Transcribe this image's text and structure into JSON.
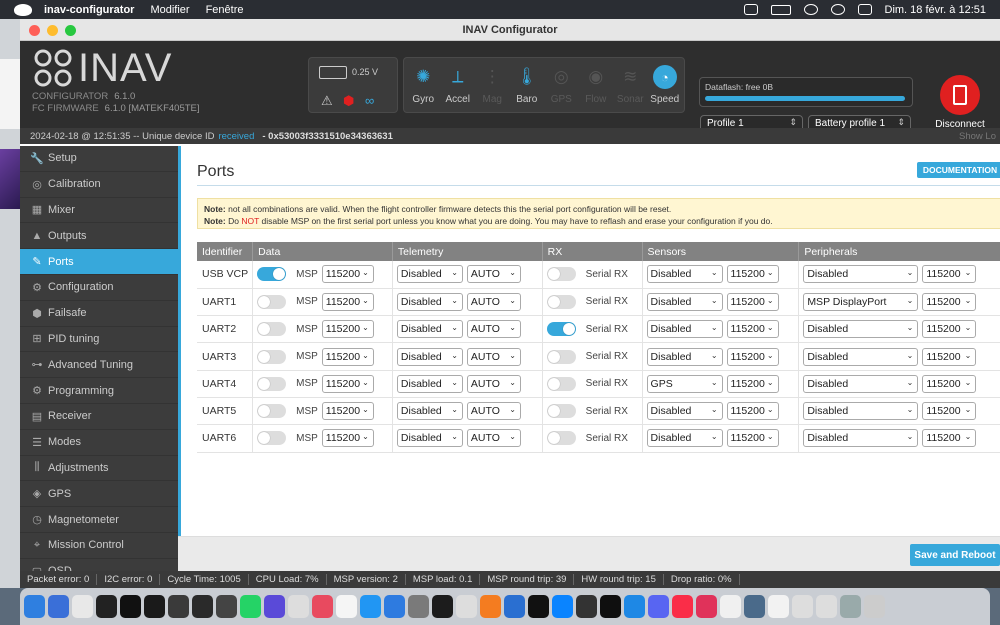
{
  "menubar": {
    "app": "inav-configurator",
    "menu1": "Modifier",
    "menu2": "Fenêtre",
    "datetime": "Dim. 18 févr. à 12:51"
  },
  "window": {
    "title": "INAV Configurator"
  },
  "header": {
    "logo_text": "INAV",
    "configurator_label": "CONFIGURATOR",
    "configurator_version": "6.1.0",
    "fw_label": "FC FIRMWARE",
    "fw_version": "6.1.0 [MATEKF405TE]",
    "voltage": "0.25 V",
    "sensors": [
      {
        "name": "Gyro",
        "icon": "gyro-icon",
        "active": true
      },
      {
        "name": "Accel",
        "icon": "accel-icon",
        "active": true
      },
      {
        "name": "Mag",
        "icon": "mag-icon",
        "active": false
      },
      {
        "name": "Baro",
        "icon": "baro-icon",
        "active": true
      },
      {
        "name": "GPS",
        "icon": "gps-icon",
        "active": false
      },
      {
        "name": "Flow",
        "icon": "flow-icon",
        "active": false
      },
      {
        "name": "Sonar",
        "icon": "sonar-icon",
        "active": false
      },
      {
        "name": "Speed",
        "icon": "speed-icon",
        "active": true
      }
    ],
    "dataflash": "Dataflash: free 0B",
    "profile": "Profile 1",
    "battery_profile": "Battery profile 1",
    "disconnect": "Disconnect"
  },
  "statusline": {
    "prefix": "2024-02-18 @ 12:51:35 -- Unique device ID",
    "received": "received",
    "device_id": "- 0x53003f3331510e34363631",
    "show_log": "Show Lo"
  },
  "sidebar": {
    "items": [
      {
        "label": "Setup",
        "icon": "wrench-icon"
      },
      {
        "label": "Calibration",
        "icon": "calibration-icon"
      },
      {
        "label": "Mixer",
        "icon": "mixer-icon"
      },
      {
        "label": "Outputs",
        "icon": "outputs-icon"
      },
      {
        "label": "Ports",
        "icon": "ports-icon",
        "active": true
      },
      {
        "label": "Configuration",
        "icon": "gear-icon"
      },
      {
        "label": "Failsafe",
        "icon": "failsafe-icon"
      },
      {
        "label": "PID tuning",
        "icon": "pid-icon"
      },
      {
        "label": "Advanced Tuning",
        "icon": "advanced-tuning-icon"
      },
      {
        "label": "Programming",
        "icon": "programming-icon"
      },
      {
        "label": "Receiver",
        "icon": "receiver-icon"
      },
      {
        "label": "Modes",
        "icon": "modes-icon"
      },
      {
        "label": "Adjustments",
        "icon": "adjustments-icon"
      },
      {
        "label": "GPS",
        "icon": "gps-icon"
      },
      {
        "label": "Magnetometer",
        "icon": "magnetometer-icon"
      },
      {
        "label": "Mission Control",
        "icon": "mission-icon"
      },
      {
        "label": "OSD",
        "icon": "osd-icon"
      }
    ]
  },
  "main": {
    "title": "Ports",
    "documentation": "DOCUMENTATION",
    "note1_label": "Note:",
    "note1": "not all combinations are valid. When the flight controller firmware detects this the serial port configuration will be reset.",
    "note2_label": "Note:",
    "note2_pre": "Do",
    "note2_not": "NOT",
    "note2_post": "disable MSP on the first serial port unless you know what you are doing. You may have to reflash and erase your configuration if you do.",
    "headers": [
      "Identifier",
      "Data",
      "Telemetry",
      "RX",
      "Sensors",
      "Peripherals"
    ],
    "msp_label": "MSP",
    "serial_rx_label": "Serial RX",
    "rows": [
      {
        "id": "USB VCP",
        "msp": true,
        "msp_baud": "115200",
        "telemetry": "Disabled",
        "telemetry_baud": "AUTO",
        "rx": false,
        "sensors": "Disabled",
        "sensors_baud": "115200",
        "peripherals": "Disabled",
        "peripherals_baud": "115200"
      },
      {
        "id": "UART1",
        "msp": false,
        "msp_baud": "115200",
        "telemetry": "Disabled",
        "telemetry_baud": "AUTO",
        "rx": false,
        "sensors": "Disabled",
        "sensors_baud": "115200",
        "peripherals": "MSP DisplayPort",
        "peripherals_baud": "115200"
      },
      {
        "id": "UART2",
        "msp": false,
        "msp_baud": "115200",
        "telemetry": "Disabled",
        "telemetry_baud": "AUTO",
        "rx": true,
        "sensors": "Disabled",
        "sensors_baud": "115200",
        "peripherals": "Disabled",
        "peripherals_baud": "115200"
      },
      {
        "id": "UART3",
        "msp": false,
        "msp_baud": "115200",
        "telemetry": "Disabled",
        "telemetry_baud": "AUTO",
        "rx": false,
        "sensors": "Disabled",
        "sensors_baud": "115200",
        "peripherals": "Disabled",
        "peripherals_baud": "115200"
      },
      {
        "id": "UART4",
        "msp": false,
        "msp_baud": "115200",
        "telemetry": "Disabled",
        "telemetry_baud": "AUTO",
        "rx": false,
        "sensors": "GPS",
        "sensors_baud": "115200",
        "peripherals": "Disabled",
        "peripherals_baud": "115200"
      },
      {
        "id": "UART5",
        "msp": false,
        "msp_baud": "115200",
        "telemetry": "Disabled",
        "telemetry_baud": "AUTO",
        "rx": false,
        "sensors": "Disabled",
        "sensors_baud": "115200",
        "peripherals": "Disabled",
        "peripherals_baud": "115200"
      },
      {
        "id": "UART6",
        "msp": false,
        "msp_baud": "115200",
        "telemetry": "Disabled",
        "telemetry_baud": "AUTO",
        "rx": false,
        "sensors": "Disabled",
        "sensors_baud": "115200",
        "peripherals": "Disabled",
        "peripherals_baud": "115200"
      }
    ],
    "save": "Save and Reboot"
  },
  "statusbar": [
    "Packet error: 0",
    "I2C error: 0",
    "Cycle Time: 1005",
    "CPU Load: 7%",
    "MSP version: 2",
    "MSP load: 0.1",
    "MSP round trip: 39",
    "HW round trip: 15",
    "Drop ratio: 0%"
  ],
  "colors": {
    "accent": "#37a8db",
    "sidebar_bg": "#3c3c3c",
    "header_bg": "#2e2e2e",
    "disconnect": "#e02020"
  }
}
